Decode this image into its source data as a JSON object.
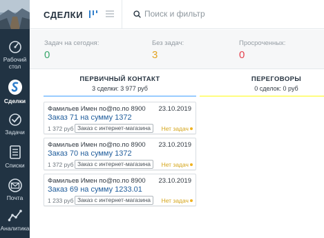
{
  "header": {
    "title": "СДЕЛКИ",
    "search_placeholder": "Поиск и фильтр"
  },
  "sidebar": {
    "items": [
      {
        "label_line1": "Рабочий",
        "label_line2": "стол",
        "icon": "speedometer-icon"
      },
      {
        "label": "Сделки",
        "icon": "deals-icon",
        "active": true
      },
      {
        "label": "Задачи",
        "icon": "tasks-check-icon"
      },
      {
        "label": "Списки",
        "icon": "lists-icon"
      },
      {
        "label": "Почта",
        "icon": "mail-icon"
      },
      {
        "label": "Аналитика",
        "icon": "analytics-icon"
      }
    ]
  },
  "summary": {
    "today": {
      "label": "Задач на сегодня:",
      "value": "0"
    },
    "no_tasks": {
      "label": "Без задач:",
      "value": "3"
    },
    "overdue": {
      "label": "Просроченных:",
      "value": "0"
    }
  },
  "columns": [
    {
      "name": "ПЕРВИЧНЫЙ КОНТАКТ",
      "summary": "3 сделки: 3 977 руб",
      "color": "#99ccff"
    },
    {
      "name": "ПЕРЕГОВОРЫ",
      "summary": "0 сделок: 0 руб",
      "color": "#fffd7f"
    }
  ],
  "cards": [
    {
      "contact": "Фамильев Имен по@по.по 8900",
      "date": "23.10.2019",
      "deal": "Заказ 71 на сумму 1372",
      "price": "1 372 руб",
      "tag": "Заказ с интернет-магазина",
      "status": "Нет задач"
    },
    {
      "contact": "Фамильев Имен по@по.по 8900",
      "date": "23.10.2019",
      "deal": "Заказ 70 на сумму 1372",
      "price": "1 372 руб",
      "tag": "Заказ с интернет-магазина",
      "status": "Нет задач"
    },
    {
      "contact": "Фамильев Имен по@по.по 8900",
      "date": "23.10.2019",
      "deal": "Заказ 69 на сумму 1233.01",
      "price": "1 233 руб",
      "tag": "Заказ с интернет-магазина",
      "status": "Нет задач"
    }
  ],
  "colors": {
    "sidebar_bg": "#213343",
    "today_value": "#3aa76d",
    "no_tasks_value": "#e2a321",
    "overdue_value": "#e5434f",
    "deal_link": "#1f5c9b"
  }
}
